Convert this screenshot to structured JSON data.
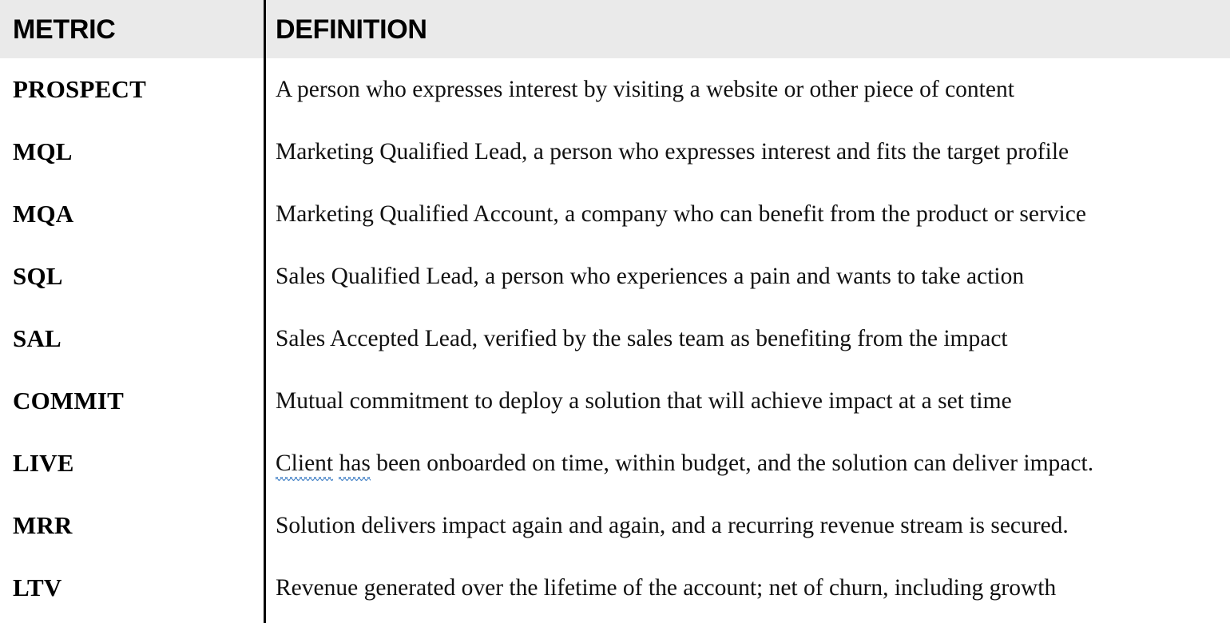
{
  "table": {
    "columns": [
      {
        "key": "metric",
        "header": "METRIC"
      },
      {
        "key": "definition",
        "header": "DEFINITION"
      }
    ],
    "header_background": "#eaeaea",
    "divider_color": "#000000",
    "spellcheck_underline_color": "#4a86c8",
    "rows": [
      {
        "metric": "PROSPECT",
        "definition": "A person who expresses interest by visiting a website or other piece of content"
      },
      {
        "metric": "MQL",
        "definition": "Marketing Qualified Lead, a person who expresses interest and fits the target profile"
      },
      {
        "metric": "MQA",
        "definition": "Marketing Qualified Account, a company who can benefit from the product or service"
      },
      {
        "metric": "SQL",
        "definition": "Sales Qualified Lead, a person who experiences a pain and wants to take action"
      },
      {
        "metric": "SAL",
        "definition": "Sales Accepted Lead, verified by the sales team as benefiting from the impact"
      },
      {
        "metric": "COMMIT",
        "definition": "Mutual commitment to deploy a solution that will achieve impact at a set time"
      },
      {
        "metric": "LIVE",
        "definition_parts": {
          "flagged_one": "Client",
          "gap_one": " ",
          "flagged_two": "has",
          "rest": " been onboarded on time, within budget, and the solution can deliver impact."
        },
        "definition": "Client has been onboarded on time, within budget, and the solution can deliver impact."
      },
      {
        "metric": "MRR",
        "definition": "Solution delivers impact again and again, and a recurring revenue stream is secured."
      },
      {
        "metric": "LTV",
        "definition": "Revenue generated over the lifetime of the account; net of churn, including growth"
      }
    ]
  }
}
